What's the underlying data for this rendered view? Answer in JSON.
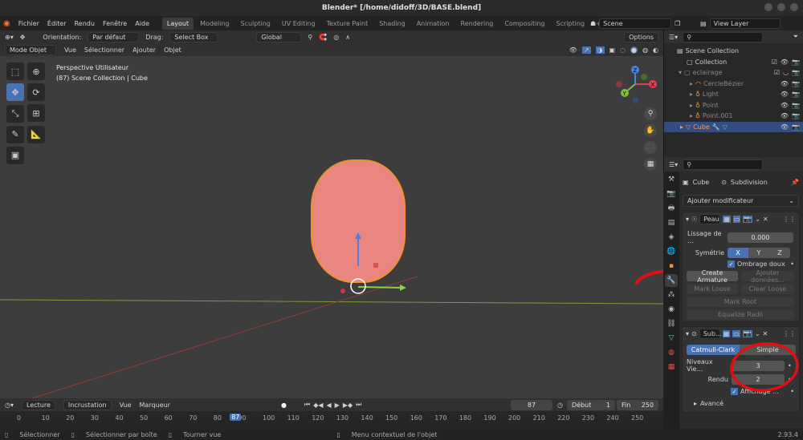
{
  "title": "Blender* [/home/didoff/3D/BASE.blend]",
  "menu": [
    "Fichier",
    "Éditer",
    "Rendu",
    "Fenêtre",
    "Aide"
  ],
  "workspaces": [
    "Layout",
    "Modeling",
    "Sculpting",
    "UV Editing",
    "Texture Paint",
    "Shading",
    "Animation",
    "Rendering",
    "Compositing",
    "Scripting"
  ],
  "scene": "Scene",
  "view_layer": "View Layer",
  "header": {
    "orientation_label": "Orientation:",
    "orientation": "Par défaut",
    "drag_label": "Drag:",
    "drag": "Select Box",
    "transform": "Global",
    "options": "Options"
  },
  "header2": {
    "mode": "Mode Objet",
    "items": [
      "Vue",
      "Sélectionner",
      "Ajouter",
      "Objet"
    ]
  },
  "viewport": {
    "line1": "Perspective Utilisateur",
    "line2": "(87) Scene Collection | Cube"
  },
  "gizmo": {
    "x": "X",
    "y": "Y",
    "z": "Z"
  },
  "outliner": {
    "rows": [
      "Scene Collection",
      "Collection",
      "eclairage",
      "CercleBézier",
      "Light",
      "Point",
      "Point.001",
      "Cube"
    ]
  },
  "props": {
    "object": "Cube",
    "modifier": "Subdivision",
    "add": "Ajouter modificateur",
    "skin": {
      "name": "Peau",
      "lissage_label": "Lissage de ...",
      "lissage": "0.000",
      "sym_label": "Symétrie",
      "x": "X",
      "y": "Y",
      "z": "Z",
      "ombrage": "Ombrage doux",
      "create": "Create Armature",
      "ajouter": "Ajouter données...",
      "mark": "Mark Loose",
      "clear": "Clear Loose",
      "markroot": "Mark Root",
      "equalize": "Equalize Radii"
    },
    "subsurf": {
      "name": "Sub...",
      "catmull": "Catmull-Clark",
      "simple": "Simple",
      "niveaux_label": "Niveaux Vie...",
      "niveaux": "3",
      "rendu_label": "Rendu",
      "rendu": "2",
      "affichage": "Affichage ...",
      "avance": "Avancé"
    }
  },
  "timeline": {
    "items": [
      "Lecture",
      "Incrustation",
      "Vue",
      "Marqueur"
    ],
    "frame": "87",
    "debut_label": "Début",
    "debut": "1",
    "fin_label": "Fin",
    "fin": "250",
    "current": "87",
    "ticks": [
      "0",
      "10",
      "20",
      "30",
      "40",
      "50",
      "60",
      "70",
      "80",
      "90",
      "100",
      "110",
      "120",
      "130",
      "140",
      "150",
      "160",
      "170",
      "180",
      "190",
      "200",
      "210",
      "220",
      "230",
      "240",
      "250"
    ]
  },
  "status": {
    "s1": "Sélectionner",
    "s2": "Sélectionner par boîte",
    "s3": "Tourner vue",
    "s4": "Menu contextuel de l'objet",
    "version": "2.93.4"
  },
  "colors": {
    "accent": "#4772b3",
    "annotation": "#e01010",
    "object": "#e8867f",
    "selection": "#f09030"
  }
}
